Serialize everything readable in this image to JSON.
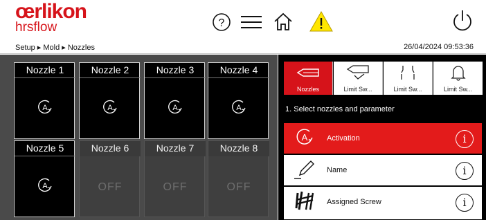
{
  "header": {
    "brand": "œrlikon",
    "brand_sub": "hrsflow",
    "breadcrumb": "Setup ▸ Mold ▸ Nozzles",
    "datetime": "26/04/2024 09:53:36",
    "icons": [
      "help-icon",
      "menu-icon",
      "home-icon",
      "warning-icon",
      "power-icon"
    ],
    "warning_color": "#ffe600"
  },
  "nozzles": [
    {
      "title": "Nozzle 1",
      "state": "active",
      "icon": "activation-icon"
    },
    {
      "title": "Nozzle 2",
      "state": "active",
      "icon": "activation-icon"
    },
    {
      "title": "Nozzle 3",
      "state": "active",
      "icon": "activation-icon"
    },
    {
      "title": "Nozzle 4",
      "state": "active",
      "icon": "activation-icon"
    },
    {
      "title": "Nozzle 5",
      "state": "active",
      "icon": "activation-icon"
    },
    {
      "title": "Nozzle 6",
      "state": "off",
      "label": "OFF"
    },
    {
      "title": "Nozzle 7",
      "state": "off",
      "label": "OFF"
    },
    {
      "title": "Nozzle 8",
      "state": "off",
      "label": "OFF"
    }
  ],
  "tabs": [
    {
      "label": "Nozzles",
      "icon": "nozzle-icon",
      "selected": true
    },
    {
      "label": "Limit Sw...",
      "icon": "nozzle-limit-icon",
      "selected": false
    },
    {
      "label": "Limit Sw...",
      "icon": "limit-switch-icon",
      "selected": false
    },
    {
      "label": "Limit Sw...",
      "icon": "bell-icon",
      "selected": false
    }
  ],
  "step_text": "1. Select nozzles and parameter",
  "parameters": [
    {
      "label": "Activation",
      "icon": "activation-icon",
      "selected": true
    },
    {
      "label": "Name",
      "icon": "pencil-icon",
      "selected": false
    },
    {
      "label": "Assigned Screw",
      "icon": "screw-icon",
      "selected": false
    }
  ],
  "colors": {
    "brand_red": "#d6131a",
    "selected_red": "#e31b1b",
    "panel_gray": "#4a4a4a"
  }
}
